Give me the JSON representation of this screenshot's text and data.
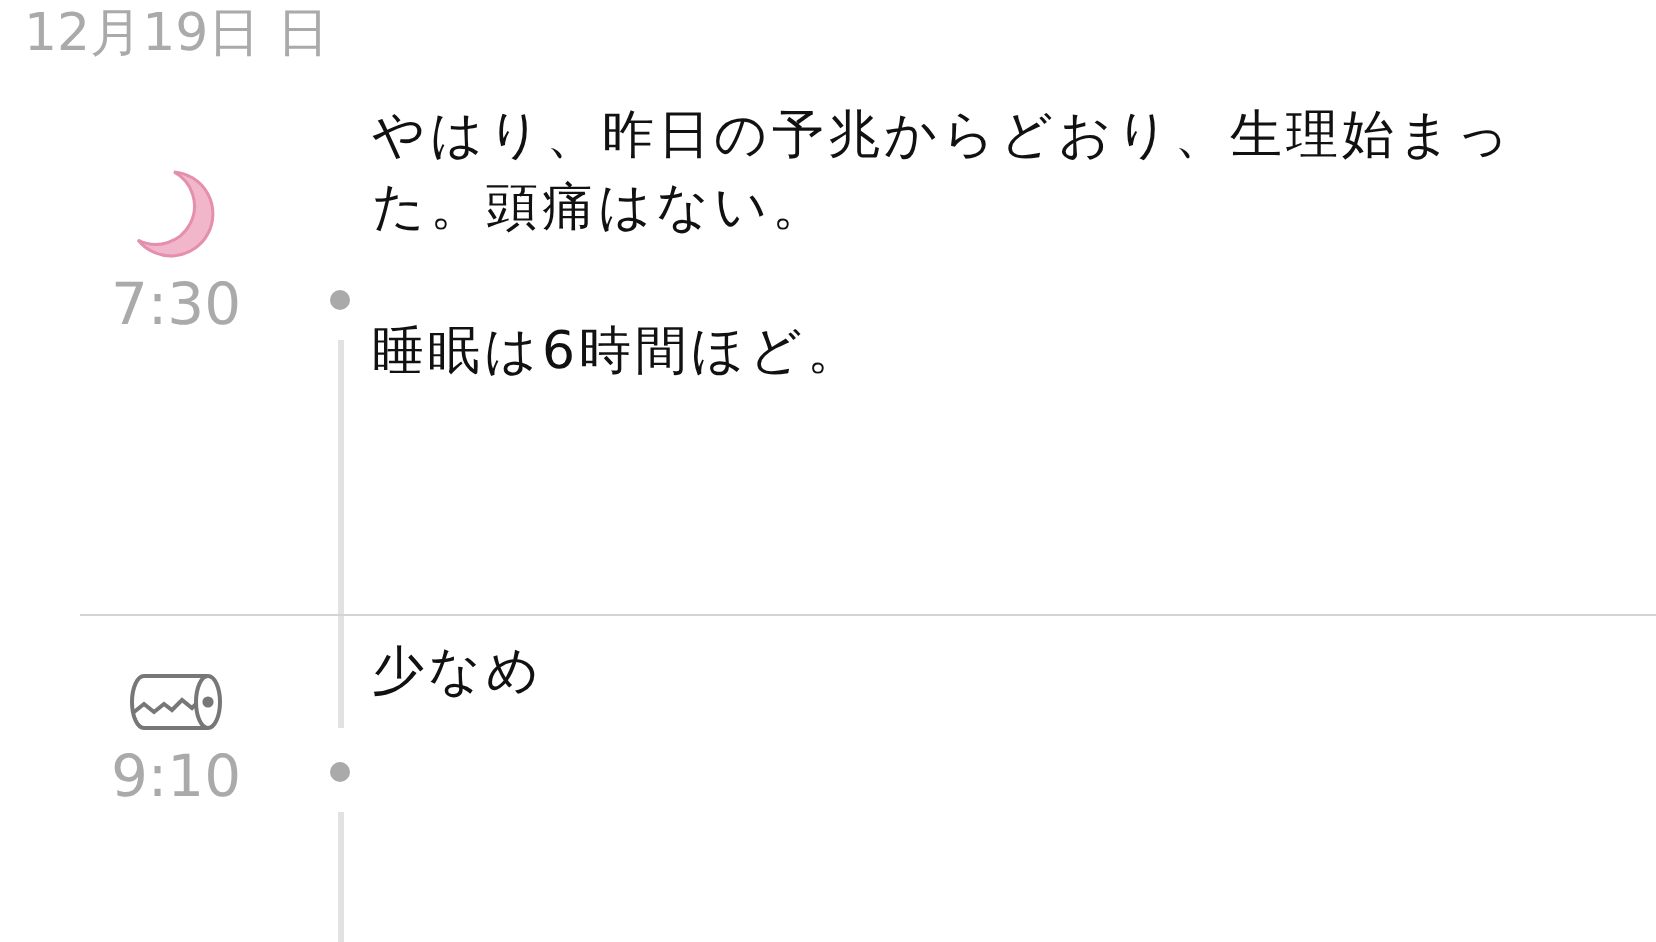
{
  "date": "12月19日 日",
  "entries": [
    {
      "kind": "moon",
      "time": "7:30",
      "paragraphs": [
        "やはり、昨日の予兆からどおり、生理始まった。頭痛はない。",
        "睡眠は6時間ほど。"
      ]
    },
    {
      "kind": "roll",
      "time": "9:10",
      "paragraphs": [
        "少なめ"
      ]
    }
  ]
}
